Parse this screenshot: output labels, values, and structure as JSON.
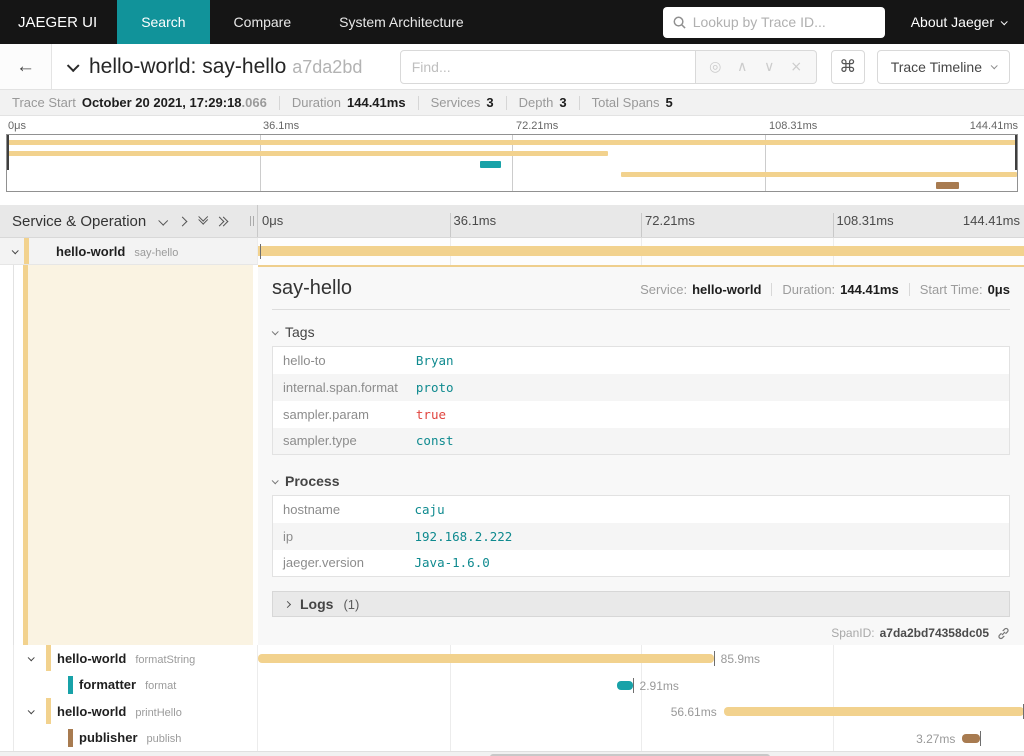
{
  "colors": {
    "tan": "#F2D28E",
    "teal": "#18A2A8",
    "brown": "#A87B50",
    "accent": "#11939A"
  },
  "icons": {
    "back": "←",
    "command": "⌘"
  },
  "navbar": {
    "brand": "JAEGER UI",
    "items": [
      {
        "label": "Search",
        "active": true
      },
      {
        "label": "Compare",
        "active": false
      },
      {
        "label": "System Architecture",
        "active": false
      }
    ],
    "lookup_placeholder": "Lookup by Trace ID...",
    "about": "About Jaeger"
  },
  "toolbar": {
    "title": "hello-world: say-hello",
    "trace_id_short": "a7da2bd",
    "find_placeholder": "Find...",
    "view_selector": "Trace Timeline",
    "find_icons": [
      {
        "name": "match-indicator-icon",
        "glyph": "◎"
      },
      {
        "name": "prev-result-icon",
        "glyph": "∧"
      },
      {
        "name": "next-result-icon",
        "glyph": "∨"
      },
      {
        "name": "clear-find-icon",
        "glyph": "×"
      }
    ]
  },
  "summary": {
    "items": [
      {
        "label": "Trace Start",
        "value": "October 20 2021, 17:29:18",
        "suffix": ".066"
      },
      {
        "label": "Duration",
        "value": "144.41ms"
      },
      {
        "label": "Services",
        "value": "3"
      },
      {
        "label": "Depth",
        "value": "3"
      },
      {
        "label": "Total Spans",
        "value": "5"
      }
    ]
  },
  "timeline": {
    "left_header": "Service & Operation",
    "total_ms": 144.41,
    "ticks": [
      "0μs",
      "36.1ms",
      "72.21ms",
      "108.31ms",
      "144.41ms"
    ],
    "tick_positions": [
      0,
      25,
      50,
      75,
      100
    ],
    "gridlines": [
      25,
      50,
      75
    ]
  },
  "spans": [
    {
      "service": "hello-world",
      "operation": "say-hello",
      "level": 1,
      "color": "tan",
      "start_ms": 0,
      "duration_ms": 144.41,
      "selected": true,
      "has_children": true,
      "duration_label": "",
      "label_side": ""
    },
    {
      "service": "hello-world",
      "operation": "formatString",
      "level": 2,
      "color": "tan",
      "start_ms": 0,
      "duration_ms": 85.9,
      "selected": false,
      "has_children": true,
      "duration_label": "85.9ms",
      "label_side": "right"
    },
    {
      "service": "formatter",
      "operation": "format",
      "level": 3,
      "color": "teal",
      "start_ms": 67.7,
      "duration_ms": 2.91,
      "selected": false,
      "has_children": false,
      "duration_label": "2.91ms",
      "label_side": "right"
    },
    {
      "service": "hello-world",
      "operation": "printHello",
      "level": 2,
      "color": "tan",
      "start_ms": 87.8,
      "duration_ms": 56.61,
      "selected": false,
      "has_children": true,
      "duration_label": "56.61ms",
      "label_side": "left"
    },
    {
      "service": "publisher",
      "operation": "publish",
      "level": 3,
      "color": "brown",
      "start_ms": 132.8,
      "duration_ms": 3.27,
      "selected": false,
      "has_children": false,
      "duration_label": "3.27ms",
      "label_side": "left"
    }
  ],
  "detail": {
    "operation": "say-hello",
    "meta": [
      {
        "label": "Service:",
        "value": "hello-world"
      },
      {
        "label": "Duration:",
        "value": "144.41ms"
      },
      {
        "label": "Start Time:",
        "value": "0μs"
      }
    ],
    "tags": {
      "title": "Tags",
      "rows": [
        {
          "key": "hello-to",
          "value": "Bryan",
          "type": "string"
        },
        {
          "key": "internal.span.format",
          "value": "proto",
          "type": "string"
        },
        {
          "key": "sampler.param",
          "value": "true",
          "type": "bool"
        },
        {
          "key": "sampler.type",
          "value": "const",
          "type": "string"
        }
      ]
    },
    "process": {
      "title": "Process",
      "rows": [
        {
          "key": "hostname",
          "value": "caju",
          "type": "string"
        },
        {
          "key": "ip",
          "value": "192.168.2.222",
          "type": "string"
        },
        {
          "key": "jaeger.version",
          "value": "Java-1.6.0",
          "type": "string"
        }
      ]
    },
    "logs": {
      "title": "Logs",
      "count": "(1)"
    },
    "span_id_label": "SpanID:",
    "span_id": "a7da2bd74358dc05"
  }
}
